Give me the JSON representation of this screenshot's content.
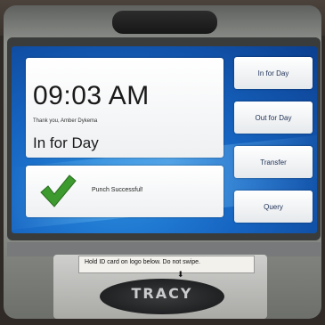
{
  "clock": {
    "time": "09:03 AM",
    "message": "Thank you, Amber Dykema",
    "status": "In for Day"
  },
  "result": {
    "icon": "check-icon",
    "text": "Punch Successful!",
    "color": "#3c9a2e"
  },
  "actions": [
    {
      "label": "In for Day"
    },
    {
      "label": "Out for Day"
    },
    {
      "label": "Transfer"
    },
    {
      "label": "Query"
    }
  ],
  "device": {
    "instruction": "Hold ID card on logo below.  Do not swipe.",
    "brand": "TRACY"
  },
  "colors": {
    "screen": "#1665c2",
    "button_text": "#1c2f55"
  }
}
